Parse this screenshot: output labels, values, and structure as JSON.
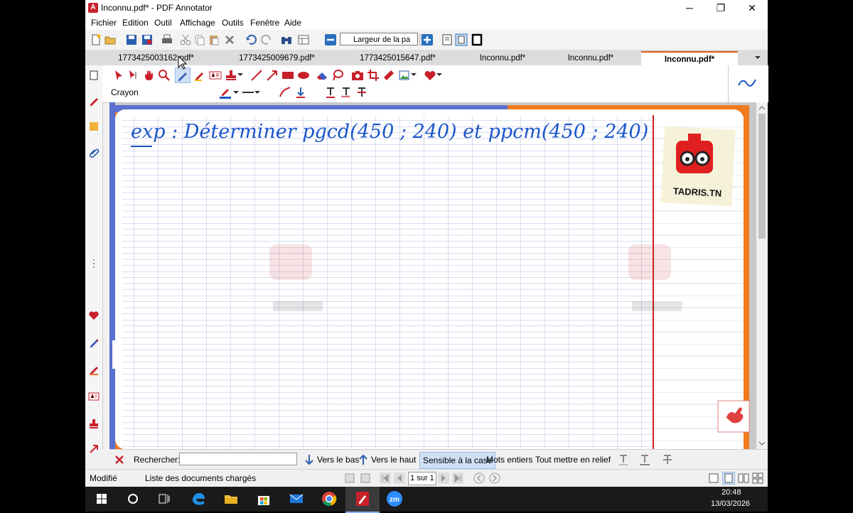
{
  "window": {
    "title": "Inconnu.pdf* - PDF Annotator",
    "controls": {
      "minimize": "─",
      "maximize": "❐",
      "close": "✕"
    }
  },
  "menu": [
    "Fichier",
    "Edition",
    "Outil",
    "Affichage",
    "Outils",
    "Fenêtre",
    "Aide"
  ],
  "toolbar": {
    "zoom_mode": "Largeur de la pa"
  },
  "tabs": [
    {
      "label": "1773425003162.pdf*",
      "active": false
    },
    {
      "label": "1773425009679.pdf*",
      "active": false
    },
    {
      "label": "1773425015647.pdf*",
      "active": false
    },
    {
      "label": "Inconnu.pdf*",
      "active": false
    },
    {
      "label": "Inconnu.pdf*",
      "active": false
    },
    {
      "label": "Inconnu.pdf*",
      "active": true
    }
  ],
  "ribbon": {
    "tool_name": "Crayon"
  },
  "document": {
    "handwriting": {
      "text": "exp : Déterminer pgcd(450 ; 240) et ppcm(450 ; 240)"
    },
    "logo_text": "TADRIS.TN"
  },
  "search": {
    "label": "Rechercher:",
    "value": "",
    "down": "Vers le bas",
    "up": "Vers le haut",
    "case": "Sensible à la case",
    "whole": "Mots entiers",
    "highlight": "Tout mettre en relief"
  },
  "status": {
    "state": "Modifié",
    "doc_list": "Liste des documents chargés",
    "page": "1 sur 1"
  },
  "taskbar": {
    "time": "20:48",
    "date": "13/03/2026"
  },
  "colors": {
    "accent": "#d65a16",
    "pen": "#1a55c9",
    "brand_red": "#c8202a"
  }
}
